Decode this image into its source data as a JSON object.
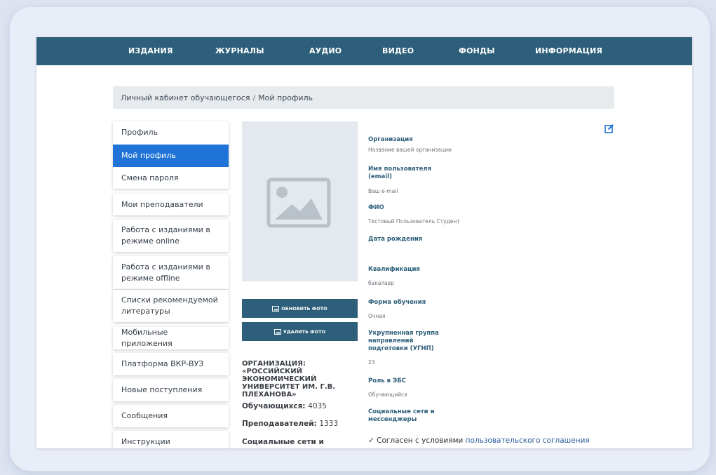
{
  "nav": {
    "items": [
      "ИЗДАНИЯ",
      "ЖУРНАЛЫ",
      "АУДИО",
      "ВИДЕО",
      "ФОНДЫ",
      "ИНФОРМАЦИЯ"
    ]
  },
  "breadcrumb": {
    "parent": "Личный кабинет обучающегося",
    "separator": "/",
    "current": "Мой профиль"
  },
  "sidebar": {
    "items": [
      {
        "label": "Профиль"
      },
      {
        "label": "Мой профиль",
        "active": true
      },
      {
        "label": "Смена пароля"
      },
      {
        "label": "Мои преподаватели"
      },
      {
        "label": "Работа с изданиями в режиме online"
      },
      {
        "label": "Работа с изданиями в режиме offline"
      },
      {
        "label": "Списки рекомендуемой литературы"
      },
      {
        "label": "Мобильные приложения"
      },
      {
        "label": "Платформа ВКР-ВУЗ"
      },
      {
        "label": "Новые поступления"
      },
      {
        "label": "Сообщения"
      },
      {
        "label": "Инструкции"
      }
    ]
  },
  "photo": {
    "update_label": "обновить фото",
    "delete_label": "удалить фото"
  },
  "organization": {
    "name": "ОРГАНИЗАЦИЯ: «РОССИЙСКИЙ ЭКОНОМИЧЕСКИЙ УНИВЕРСИТЕТ ИМ. Г.В. ПЛЕХАНОВА»",
    "students_label": "Обучающихся:",
    "students_value": "4035",
    "teachers_label": "Преподавателей:",
    "teachers_value": "1333",
    "social_label": "Социальные сети и мессенджеры библиотеки:"
  },
  "profile": {
    "fields": [
      {
        "label": "Организация",
        "value": "Название вашей организации"
      },
      {
        "label": "Имя пользователя (email)",
        "value": "Ваш e-mail"
      },
      {
        "label": "ФИО",
        "value": "Тестовый Пользователь Студент"
      },
      {
        "label": "Дата рождения",
        "value": ""
      },
      {
        "label": "Квалификация",
        "value": "бакалавр"
      },
      {
        "label": "Форма обучения",
        "value": "Очная"
      },
      {
        "label": "Укрупненная группа направлений подготовки (УГНП)",
        "value": "23"
      },
      {
        "label": "Роль в ЭБС",
        "value": "Обучающийся"
      },
      {
        "label": "Социальные сети и мессенджеры",
        "value": ""
      }
    ],
    "agreement_check": "✓",
    "agreement_text": "Согласен с условиями",
    "agreement_link": "пользовательского соглашения"
  },
  "colors": {
    "nav_bg": "#2e5f7a",
    "active_item": "#1f73d6",
    "label_color": "#2e5f7a"
  }
}
